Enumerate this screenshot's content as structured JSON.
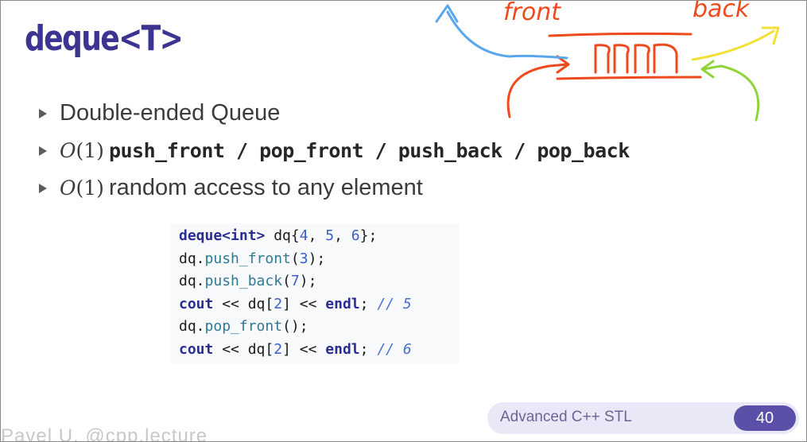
{
  "slide": {
    "title": "deque<T>",
    "bullets": [
      {
        "text": "Double-ended Queue"
      },
      {
        "math": "O",
        "paren_open": "(",
        "num": "1",
        "paren_close": ")",
        "ops": "push_front / pop_front / push_back / pop_back"
      },
      {
        "math": "O",
        "paren_open": "(",
        "num": "1",
        "paren_close": ")",
        "text": "random access to any element"
      }
    ],
    "code": {
      "line1": {
        "type": "deque<int>",
        "rest": " dq{",
        "a": "4",
        "c1": ", ",
        "b": "5",
        "c2": ", ",
        "c": "6",
        "end": "};"
      },
      "line2": {
        "obj": "dq.",
        "fn": "push_front",
        "open": "(",
        "arg": "3",
        "close": ");"
      },
      "line3": {
        "obj": "dq.",
        "fn": "push_back",
        "open": "(",
        "arg": "7",
        "close": ");"
      },
      "line4": {
        "cout": "cout",
        "op1": " << ",
        "expr": "dq[",
        "idx": "2",
        "expr2": "]",
        "op2": " << ",
        "endl": "endl",
        "semi": "; ",
        "comment": "// 5"
      },
      "line5": {
        "obj": "dq.",
        "fn": "pop_front",
        "call": "();"
      },
      "line6": {
        "cout": "cout",
        "op1": " << ",
        "expr": "dq[",
        "idx": "2",
        "expr2": "]",
        "op2": " << ",
        "endl": "endl",
        "semi": "; ",
        "comment": "// 6"
      }
    }
  },
  "annotation": {
    "front_label": "front",
    "back_label": "back",
    "colors": {
      "red": "#ee4a1e",
      "blue": "#5aa7ee",
      "yellow": "#f2e035",
      "green": "#8fd53a"
    }
  },
  "footer": {
    "course": "Advanced C++ STL",
    "page": "40"
  },
  "webcam_overlay": "Pavel U. @cpp.lecture"
}
